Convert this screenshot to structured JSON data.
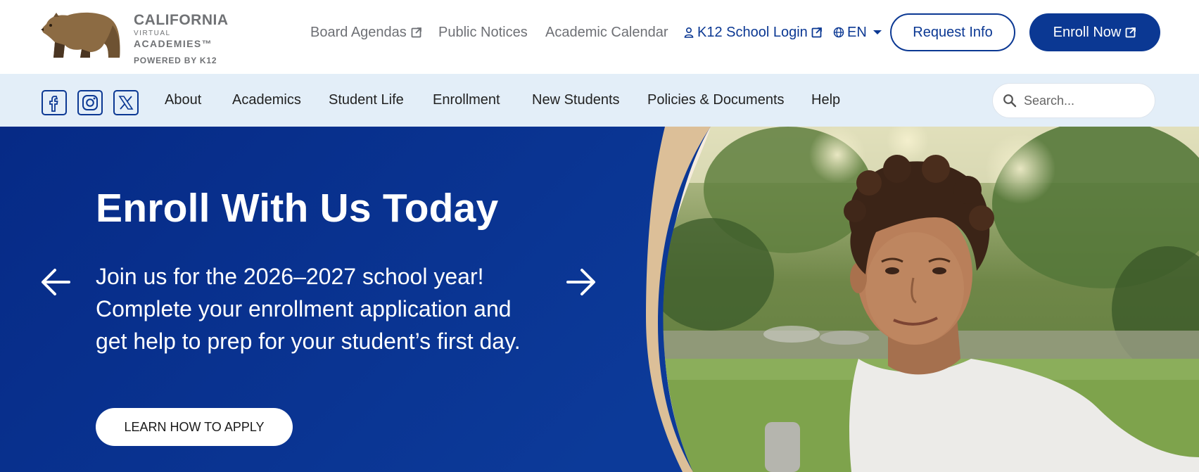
{
  "logo": {
    "line1": "CALIFORNIA",
    "line2": "VIRTUAL",
    "line3": "ACADEMIES™",
    "line4": "POWERED BY K12",
    "icon": "bear-icon"
  },
  "utility_nav": {
    "board_agendas": "Board Agendas",
    "public_notices": "Public Notices",
    "academic_calendar": "Academic Calendar",
    "school_login": "K12 School Login",
    "language": "EN",
    "request_info": "Request Info",
    "enroll_now": "Enroll Now"
  },
  "social": [
    "facebook-icon",
    "instagram-icon",
    "x-icon"
  ],
  "main_nav": {
    "items": [
      "About",
      "Academics",
      "Student Life",
      "Enrollment",
      "New Students",
      "Policies & Documents",
      "Help"
    ]
  },
  "search": {
    "placeholder": "Search..."
  },
  "hero": {
    "title": "Enroll With Us Today",
    "body": "Join us for the 2026–2027 school year! Complete your enrollment application and get help to prep for your student’s first day.",
    "cta": "LEARN HOW TO APPLY"
  },
  "colors": {
    "brand_blue": "#0b3893",
    "nav_bg": "#e3eef8",
    "tan": "#dcbf98",
    "cream": "#f6ecdd"
  }
}
